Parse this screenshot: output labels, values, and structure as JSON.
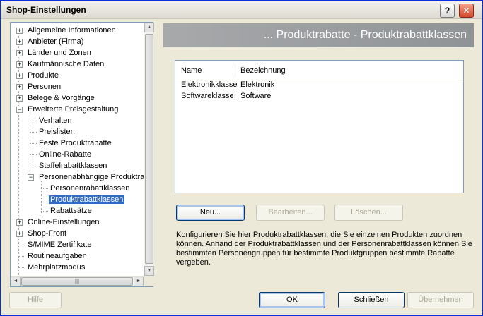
{
  "window": {
    "title": "Shop-Einstellungen",
    "help_glyph": "?",
    "close_glyph": "✕"
  },
  "tree": {
    "items": [
      {
        "label": "Allgemeine Informationen",
        "expander": "+"
      },
      {
        "label": "Anbieter (Firma)",
        "expander": "+"
      },
      {
        "label": "Länder und Zonen",
        "expander": "+"
      },
      {
        "label": "Kaufmännische Daten",
        "expander": "+"
      },
      {
        "label": "Produkte",
        "expander": "+"
      },
      {
        "label": "Personen",
        "expander": "+"
      },
      {
        "label": "Belege & Vorgänge",
        "expander": "+"
      },
      {
        "label": "Erweiterte Preisgestaltung",
        "expander": "−"
      },
      {
        "label": "Verhalten"
      },
      {
        "label": "Preislisten"
      },
      {
        "label": "Feste Produktrabatte"
      },
      {
        "label": "Online-Rabatte"
      },
      {
        "label": "Staffelrabattklassen"
      },
      {
        "label": "Personenabhängige Produktra",
        "expander": "−"
      },
      {
        "label": "Personenrabattklassen"
      },
      {
        "label": "Produktrabattklassen",
        "selected": true
      },
      {
        "label": "Rabattsätze"
      },
      {
        "label": "Online-Einstellungen",
        "expander": "+"
      },
      {
        "label": "Shop-Front",
        "expander": "+"
      },
      {
        "label": "S/MIME Zertifikate"
      },
      {
        "label": "Routineaufgaben"
      },
      {
        "label": "Mehrplatzmodus"
      }
    ]
  },
  "header": {
    "title": "... Produktrabatte - Produktrabattklassen"
  },
  "list": {
    "columns": [
      "Name",
      "Bezeichnung"
    ],
    "rows": [
      [
        "Elektronikklasse",
        "Elektronik"
      ],
      [
        "Softwareklasse",
        "Software"
      ]
    ]
  },
  "actions": {
    "new": "Neu...",
    "edit": "Bearbeiten...",
    "delete": "Löschen..."
  },
  "description": "Konfigurieren Sie hier Produktrabattklassen, die Sie einzelnen Produkten zuordnen können. Anhand der Produktrabattklassen und der Personenrabattklassen können Sie bestimmten Personengruppen für bestimmte Produktgruppen bestimmte Rabatte vergeben.",
  "footer": {
    "help": "Hilfe",
    "ok": "OK",
    "close": "Schließen",
    "apply": "Übernehmen"
  },
  "icons": {
    "scroll_up": "▲",
    "scroll_down": "▼",
    "scroll_left": "◄",
    "scroll_right": "►",
    "grip": "|||"
  }
}
